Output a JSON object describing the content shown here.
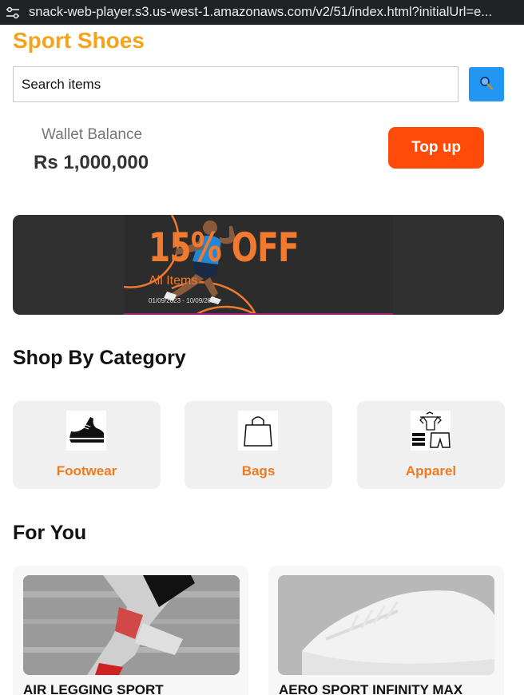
{
  "browser": {
    "url": "snack-web-player.s3.us-west-1.amazonaws.com/v2/51/index.html?initialUrl=e..."
  },
  "app": {
    "title": "Sport Shoes"
  },
  "search": {
    "placeholder": "Search items",
    "value": ""
  },
  "wallet": {
    "label": "Wallet Balance",
    "amount": "Rs 1,000,000",
    "topup_label": "Top up"
  },
  "banner": {
    "headline": "15% OFF",
    "subtitle": "All Items",
    "dates": "01/09/2023 -  10/09/2023"
  },
  "categories": {
    "title": "Shop By Category",
    "items": [
      {
        "label": "Footwear",
        "icon": "shoe-icon"
      },
      {
        "label": "Bags",
        "icon": "bag-icon"
      },
      {
        "label": "Apparel",
        "icon": "apparel-icon"
      }
    ]
  },
  "for_you": {
    "title": "For You",
    "products": [
      {
        "name": "AIR LEGGING SPORT"
      },
      {
        "name": "AERO SPORT INFINITY MAX"
      }
    ]
  },
  "colors": {
    "brand": "#f5a31a",
    "accent": "#ff4b0a",
    "category_label": "#f07a1e",
    "search_button": "#2196f3",
    "banner_bg": "#303030"
  }
}
